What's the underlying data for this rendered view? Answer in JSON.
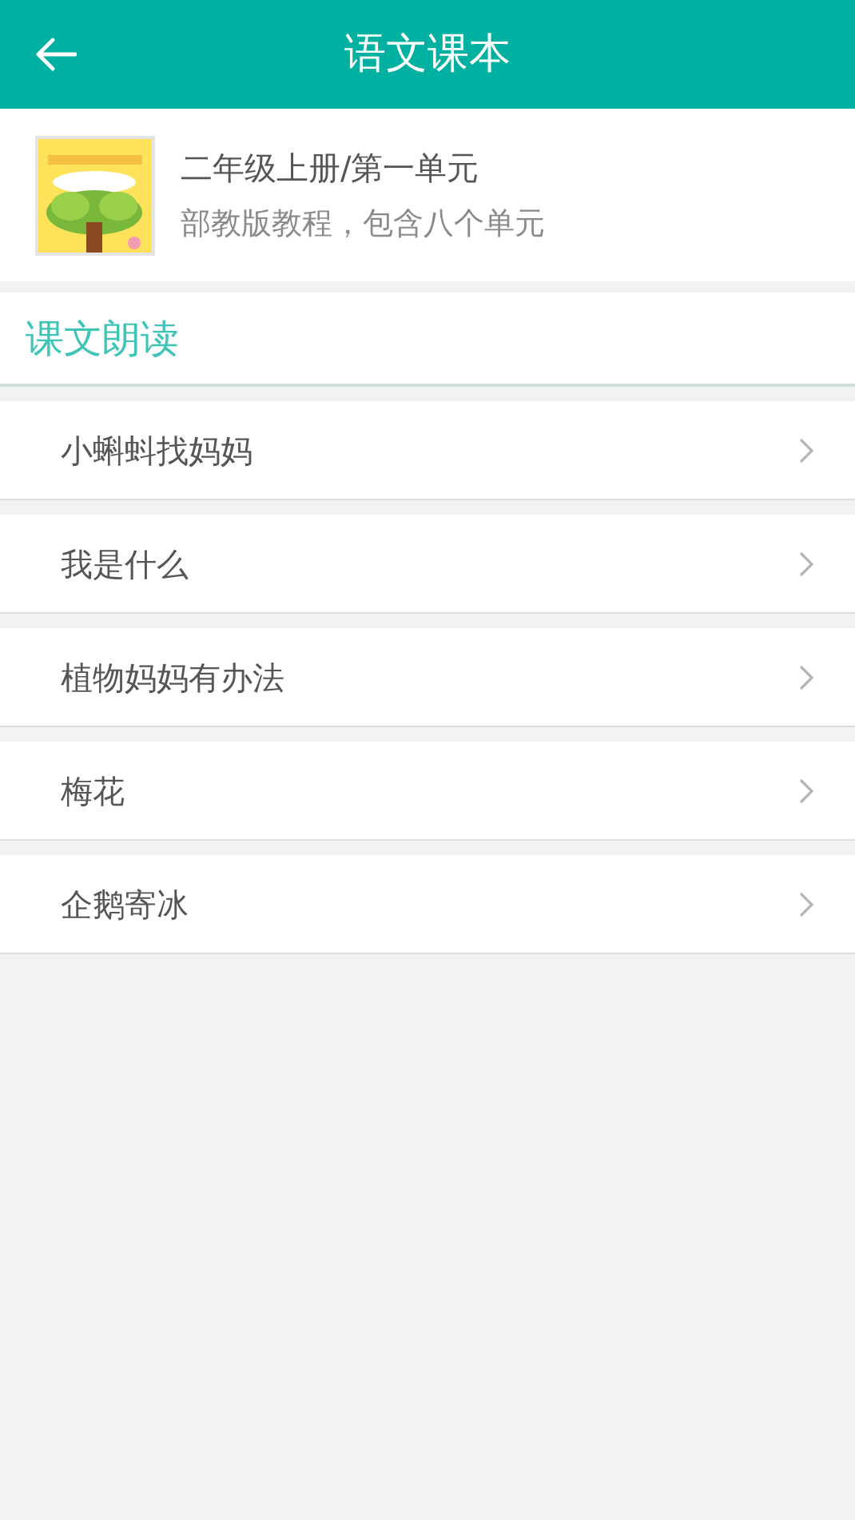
{
  "header": {
    "title": "语文课本"
  },
  "book": {
    "title": "二年级上册/第一单元",
    "subtitle": "部教版教程，包含八个单元"
  },
  "section": {
    "title": "课文朗读"
  },
  "lessons": [
    {
      "title": "小蝌蚪找妈妈"
    },
    {
      "title": "我是什么"
    },
    {
      "title": "植物妈妈有办法"
    },
    {
      "title": "梅花"
    },
    {
      "title": "企鹅寄冰"
    }
  ]
}
